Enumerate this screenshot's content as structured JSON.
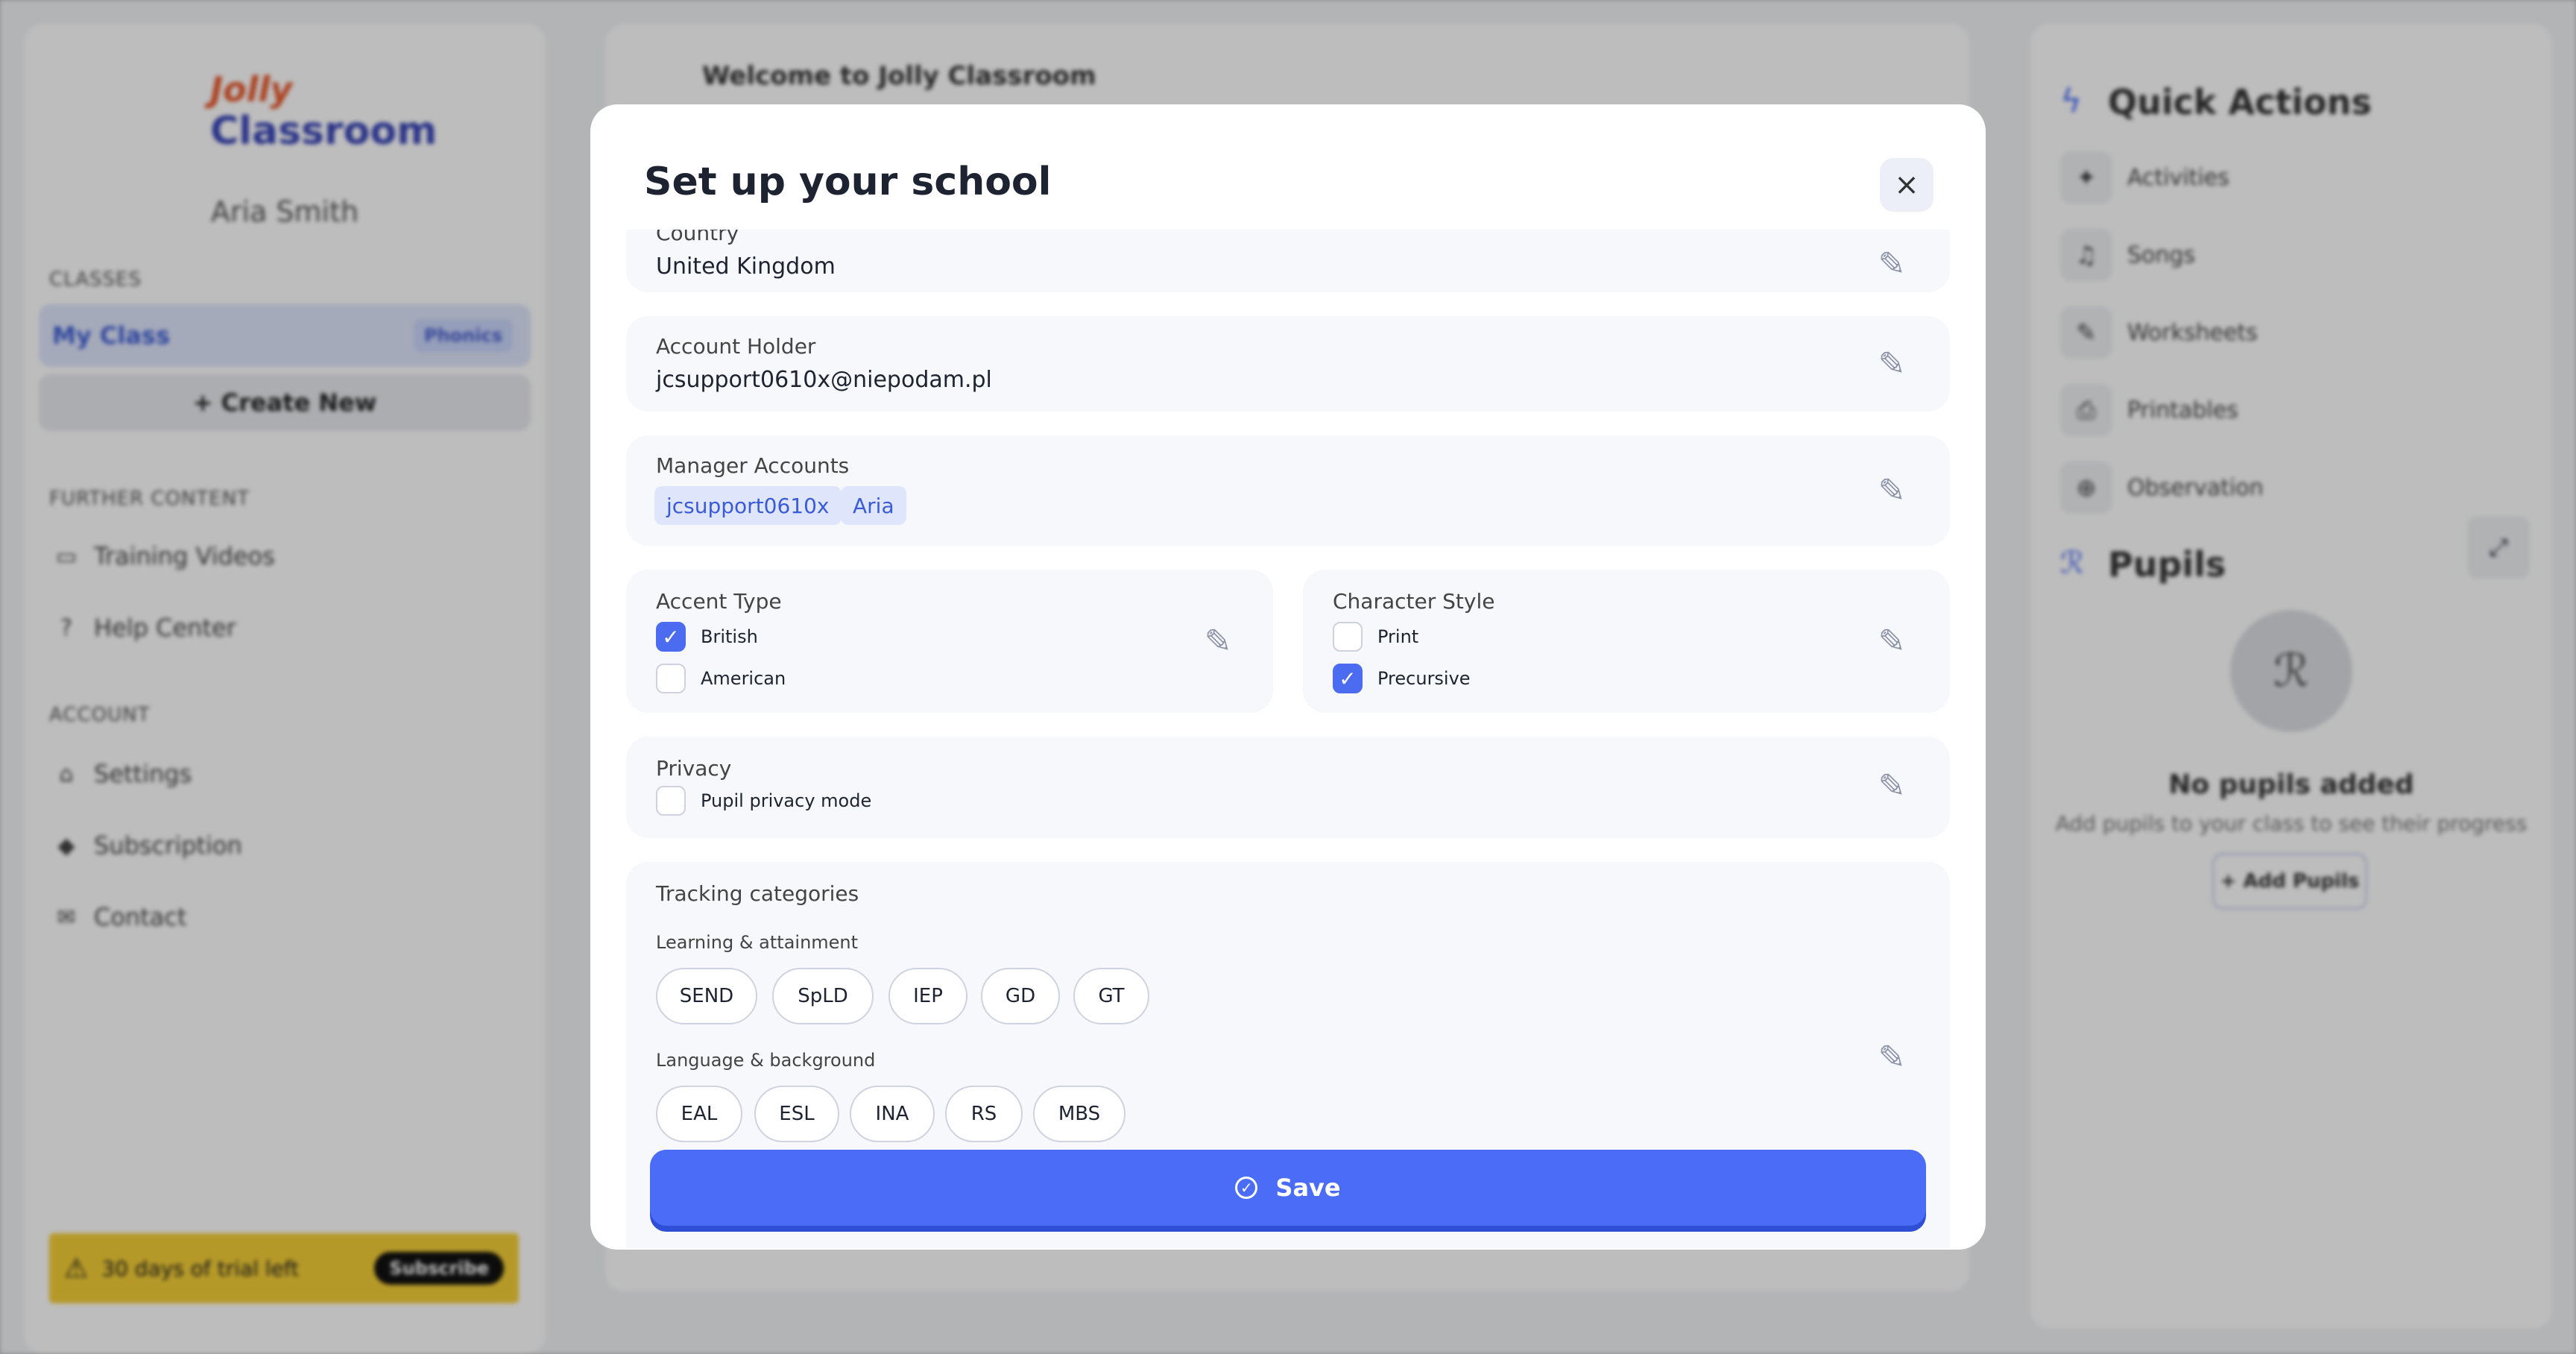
{
  "background": {
    "sidebar": {
      "logo_top": "Jolly",
      "logo_bottom": "Classroom",
      "username": "Aria Smith",
      "classes_title": "CLASSES",
      "my_class": "My Class",
      "my_class_badge": "Phonics",
      "create_new": "+ Create New",
      "further_title": "FURTHER CONTENT",
      "training_videos": "Training Videos",
      "help_center": "Help Center",
      "account_title": "ACCOUNT",
      "settings": "Settings",
      "subscription": "Subscription",
      "contact": "Contact",
      "trial_text": "30 days of trial left",
      "subscribe": "Subscribe"
    },
    "main": {
      "welcome": "Welcome to Jolly Classroom"
    },
    "quick_actions": {
      "title": "Quick Actions",
      "items": [
        "Activities",
        "Songs",
        "Worksheets",
        "Printables",
        "Observation"
      ]
    },
    "pupils": {
      "title": "Pupils",
      "empty_title": "No pupils added",
      "empty_sub": "Add pupils to your class to see their progress",
      "add_button": "+ Add Pupils"
    }
  },
  "modal": {
    "title": "Set up your school",
    "country": {
      "label": "Country",
      "value": "United Kingdom"
    },
    "account_holder": {
      "label": "Account Holder",
      "value": "jcsupport0610x@niepodam.pl"
    },
    "manager_accounts": {
      "label": "Manager Accounts",
      "tags": [
        "jcsupport0610x",
        "Aria"
      ]
    },
    "accent_type": {
      "label": "Accent Type",
      "options": [
        {
          "label": "British",
          "checked": true
        },
        {
          "label": "American",
          "checked": false
        }
      ]
    },
    "character_style": {
      "label": "Character Style",
      "options": [
        {
          "label": "Print",
          "checked": false
        },
        {
          "label": "Precursive",
          "checked": true
        }
      ]
    },
    "privacy": {
      "label": "Privacy",
      "option": {
        "label": "Pupil privacy mode",
        "checked": false
      }
    },
    "tracking": {
      "label": "Tracking categories",
      "learning": {
        "title": "Learning & attainment",
        "items": [
          "SEND",
          "SpLD",
          "IEP",
          "GD",
          "GT"
        ]
      },
      "language": {
        "title": "Language & background",
        "items": [
          "EAL",
          "ESL",
          "INA",
          "RS",
          "MBS"
        ]
      }
    },
    "save_label": "Save"
  },
  "colors": {
    "accent": "#4a6cf7",
    "tag_bg": "#dfe6fb",
    "trial_bg": "#f5cf37"
  }
}
